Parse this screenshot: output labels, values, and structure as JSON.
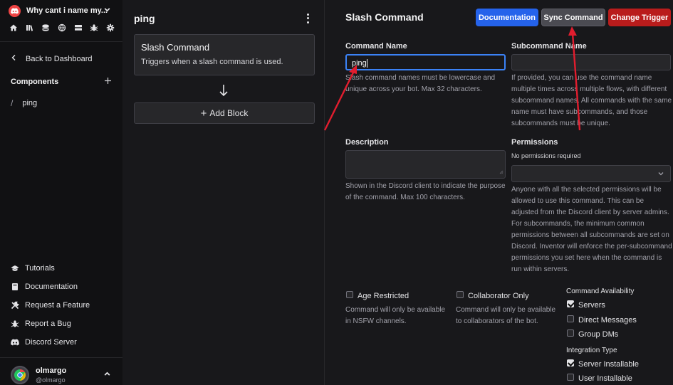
{
  "sidebar": {
    "server_name": "Why cant i name my...",
    "back_label": "Back to Dashboard",
    "components_label": "Components",
    "components": [
      {
        "label": "ping"
      }
    ],
    "links": [
      {
        "label": "Tutorials",
        "icon": "graduation-cap-icon"
      },
      {
        "label": "Documentation",
        "icon": "book-icon"
      },
      {
        "label": "Request a Feature",
        "icon": "tools-icon"
      },
      {
        "label": "Report a Bug",
        "icon": "bug-icon"
      },
      {
        "label": "Discord Server",
        "icon": "discord-icon"
      }
    ],
    "user": {
      "name": "olmargo",
      "handle": "@olmargo"
    }
  },
  "flow": {
    "title": "ping",
    "trigger": {
      "title": "Slash Command",
      "description": "Triggers when a slash command is used."
    },
    "add_block_label": "Add Block"
  },
  "main": {
    "title": "Slash Command",
    "buttons": {
      "documentation": "Documentation",
      "sync": "Sync Command",
      "change": "Change Trigger"
    },
    "command_name": {
      "label": "Command Name",
      "value": "ping",
      "help": "Slash command names must be lowercase and unique across your bot. Max 32 characters."
    },
    "subcommand_name": {
      "label": "Subcommand Name",
      "value": "",
      "help": "If provided, you can use the command name multiple times across multiple flows, with different subcommand names. All commands with the same name must have subcommands, and those subcommands must be unique."
    },
    "description": {
      "label": "Description",
      "value": "",
      "help": "Shown in the Discord client to indicate the purpose of the command. Max 100 characters."
    },
    "permissions": {
      "label": "Permissions",
      "selected": "No permissions required",
      "help": "Anyone with all the selected permissions will be allowed to use this command. This can be adjusted from the Discord client by server admins. For subcommands, the minimum common permissions between all subcommands are set on Discord. Inventor will enforce the per-subcommand permissions you set here when the command is run within servers."
    },
    "age_restricted": {
      "label": "Age Restricted",
      "checked": false,
      "help": "Command will only be available in NSFW channels."
    },
    "collaborator_only": {
      "label": "Collaborator Only",
      "checked": false,
      "help": "Command will only be available to collaborators of the bot."
    },
    "availability": {
      "label": "Command Availability",
      "options": [
        {
          "label": "Servers",
          "checked": true
        },
        {
          "label": "Direct Messages",
          "checked": false
        },
        {
          "label": "Group DMs",
          "checked": false
        }
      ]
    },
    "integration": {
      "label": "Integration Type",
      "options": [
        {
          "label": "Server Installable",
          "checked": true
        },
        {
          "label": "User Installable",
          "checked": false
        }
      ]
    }
  },
  "colors": {
    "accent_blue": "#2563eb",
    "danger_red": "#b91c1c",
    "annotation_red": "#e11d2e",
    "background": "#18181b",
    "sidebar": "#111113"
  }
}
